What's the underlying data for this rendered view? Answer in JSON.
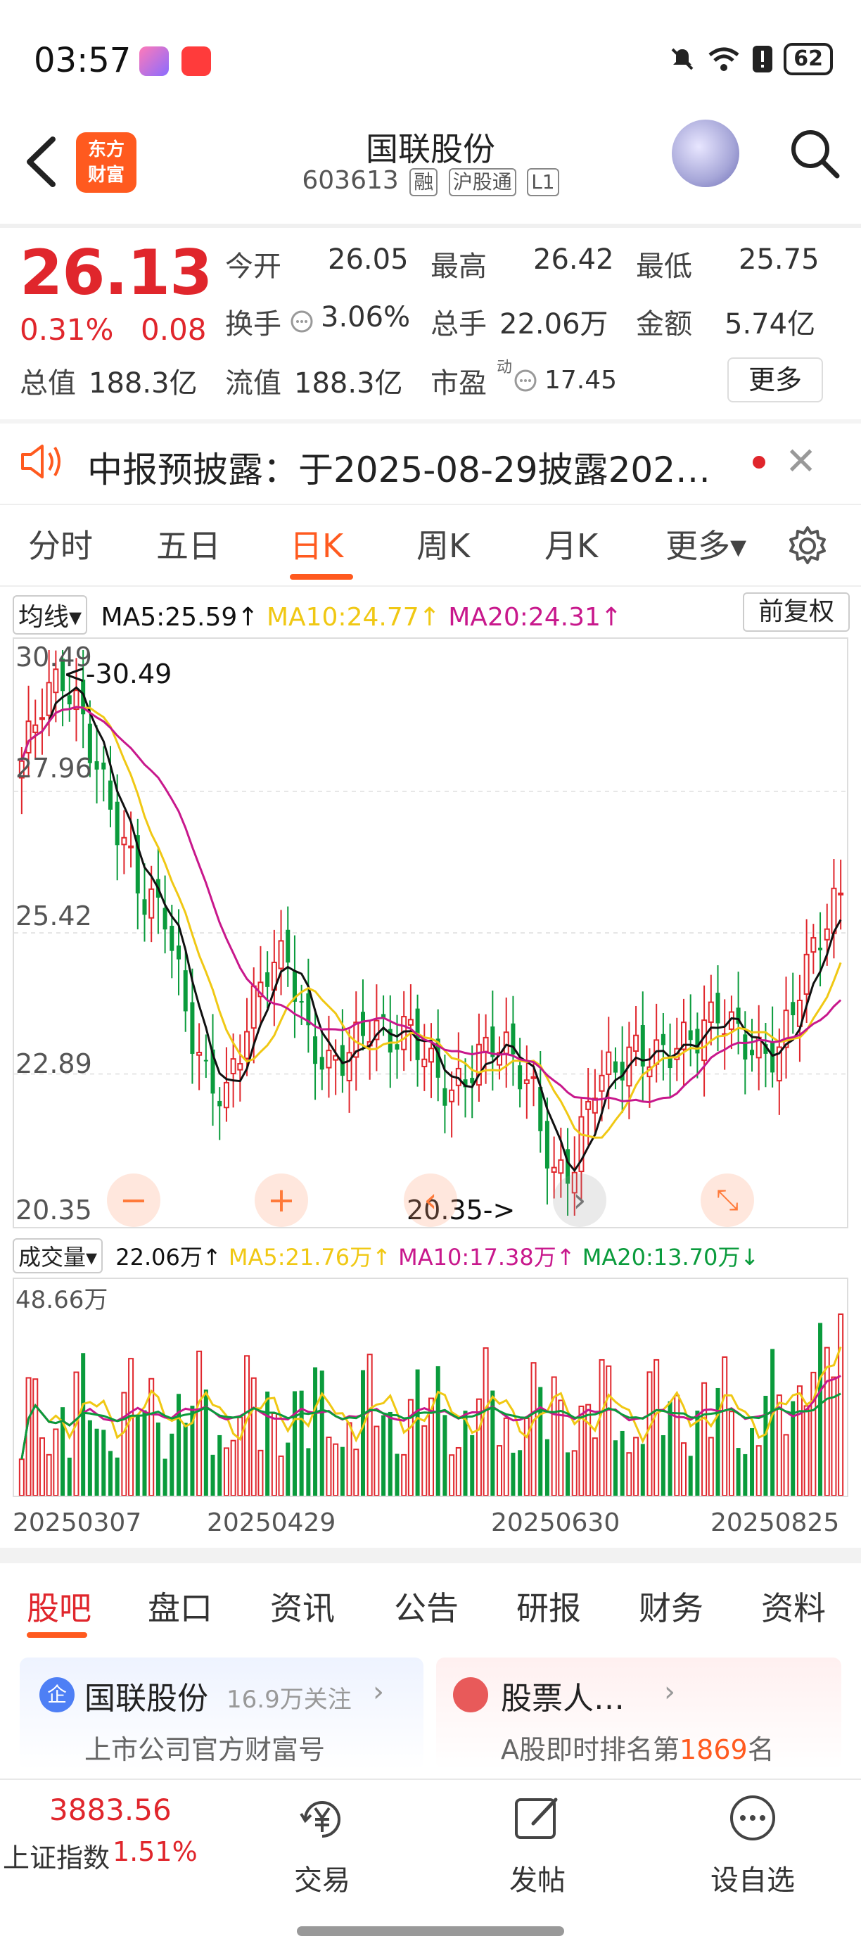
{
  "status": {
    "time": "03:57",
    "battery": "62"
  },
  "header": {
    "logo_line1": "东方",
    "logo_line2": "财富",
    "title": "国联股份",
    "code": "603613",
    "tags": [
      "融",
      "沪股通",
      "L1"
    ]
  },
  "quote": {
    "price": "26.13",
    "change_pct": "0.31%",
    "change": "0.08",
    "open_label": "今开",
    "open": "26.05",
    "high_label": "最高",
    "high": "26.42",
    "low_label": "最低",
    "low": "25.75",
    "turnover_label": "换手",
    "turnover": "3.06%",
    "volume_label": "总手",
    "volume": "22.06万",
    "amount_label": "金额",
    "amount": "5.74亿",
    "total_cap_label": "总值",
    "total_cap": "188.3亿",
    "float_cap_label": "流值",
    "float_cap": "188.3亿",
    "pe_label": "市盈",
    "pe_sup": "动",
    "pe": "17.45",
    "more_label": "更多"
  },
  "notice": {
    "text": "中报预披露：于2025-08-29披露202…"
  },
  "tabs": {
    "items": [
      "分时",
      "五日",
      "日K",
      "周K",
      "月K",
      "更多▾"
    ],
    "active": "日K"
  },
  "ma_bar": {
    "select_label": "均线▾",
    "ma5": "MA5:25.59↑",
    "ma10": "MA10:24.77↑",
    "ma20": "MA20:24.31↑",
    "fuquan": "前复权"
  },
  "kline": {
    "y_ticks": [
      "30.49",
      "27.96",
      "25.42",
      "22.89",
      "20.35"
    ],
    "max_label": "<-30.49",
    "min_label": "20.35->"
  },
  "vol_bar": {
    "select_label": "成交量▾",
    "value": "22.06万↑",
    "ma5": "MA5:21.76万↑",
    "ma10": "MA10:17.38万↑",
    "ma20": "MA20:13.70万↓",
    "max_label": "48.66万"
  },
  "dates": [
    "20250307",
    "20250429",
    "20250630",
    "20250825"
  ],
  "bottom_tabs": [
    "股吧",
    "盘口",
    "资讯",
    "公告",
    "研报",
    "财务",
    "资料"
  ],
  "cards": {
    "left_badge": "企",
    "left_title": "国联股份",
    "left_follow": "16.9万关注",
    "left_sub": "上市公司官方财富号",
    "right_title": "股票人…",
    "right_sub_prefix": "A股即时排名第",
    "right_rank": "1869",
    "right_sub_suffix": "名"
  },
  "nav": {
    "index_value": "3883.56",
    "index_name": "上证指数",
    "index_pct": "1.51%",
    "trade": "交易",
    "post": "发帖",
    "watch": "设自选"
  },
  "colors": {
    "up": "#e0262c",
    "down": "#0a9b3c",
    "accent": "#ff5a1f",
    "ma5": "#111111",
    "ma10": "#f0c814",
    "ma20": "#c8188c"
  },
  "chart_data": {
    "type": "candlestick",
    "y_range": [
      20.35,
      30.49
    ],
    "volume_max": "48.66万",
    "x_labels": [
      "20250307",
      "20250429",
      "20250630",
      "20250825"
    ],
    "approx_close": [
      28.5,
      29.6,
      30.0,
      29.2,
      28.0,
      27.0,
      26.0,
      25.8,
      24.0,
      22.8,
      22.5,
      23.8,
      24.8,
      25.0,
      23.5,
      23.0,
      23.3,
      23.8,
      23.5,
      23.7,
      23.0,
      22.5,
      23.0,
      23.5,
      23.2,
      22.5,
      21.0,
      21.3,
      22.8,
      23.0,
      23.3,
      23.2,
      23.4,
      23.6,
      24.0,
      23.6,
      23.2,
      23.3,
      24.5,
      25.4,
      26.13
    ]
  }
}
